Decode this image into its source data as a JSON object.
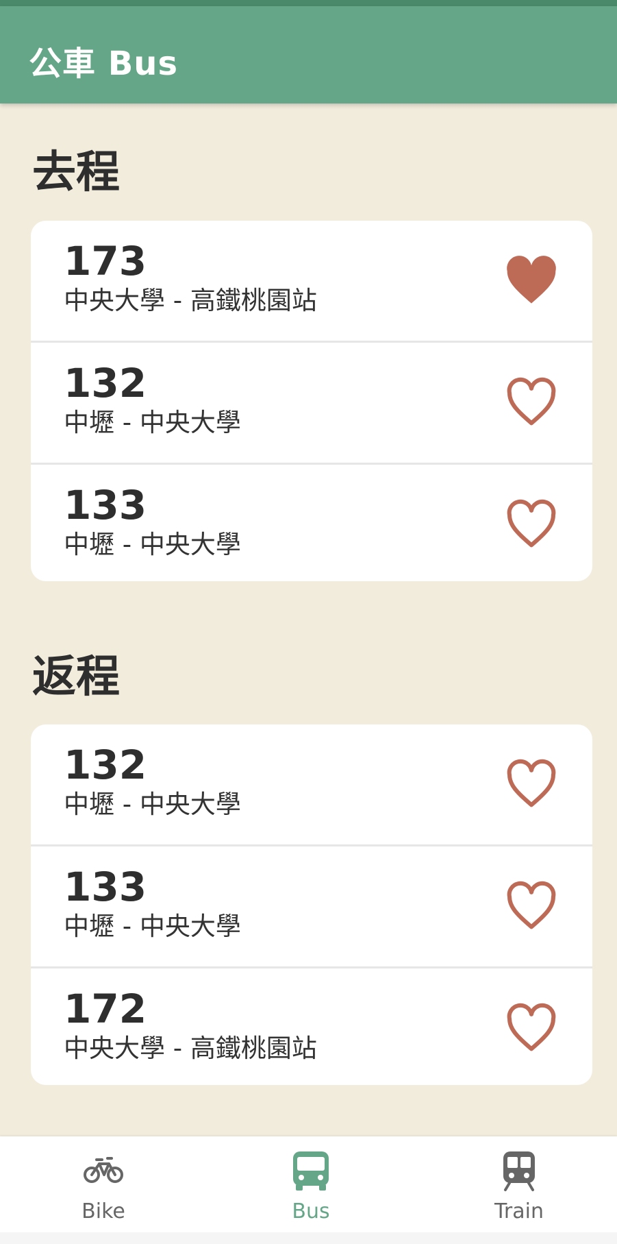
{
  "app": {
    "title": "公車 Bus"
  },
  "sections": [
    {
      "title": "去程",
      "routes": [
        {
          "number": "173",
          "desc": "中央大學 - 高鐵桃園站",
          "favorite": true
        },
        {
          "number": "132",
          "desc": "中壢 - 中央大學",
          "favorite": false
        },
        {
          "number": "133",
          "desc": "中壢 - 中央大學",
          "favorite": false
        }
      ]
    },
    {
      "title": "返程",
      "routes": [
        {
          "number": "132",
          "desc": "中壢 - 中央大學",
          "favorite": false
        },
        {
          "number": "133",
          "desc": "中壢 - 中央大學",
          "favorite": false
        },
        {
          "number": "172",
          "desc": "中央大學 - 高鐵桃園站",
          "favorite": false
        }
      ]
    }
  ],
  "nav": {
    "items": [
      {
        "label": "Bike",
        "icon": "bike-icon",
        "active": false
      },
      {
        "label": "Bus",
        "icon": "bus-icon",
        "active": true
      },
      {
        "label": "Train",
        "icon": "train-icon",
        "active": false
      }
    ]
  },
  "colors": {
    "appbar": "#65a688",
    "background": "#f2ecdd",
    "heart": "#bd6b57",
    "active_nav": "#65a688",
    "inactive_nav": "#666666"
  }
}
